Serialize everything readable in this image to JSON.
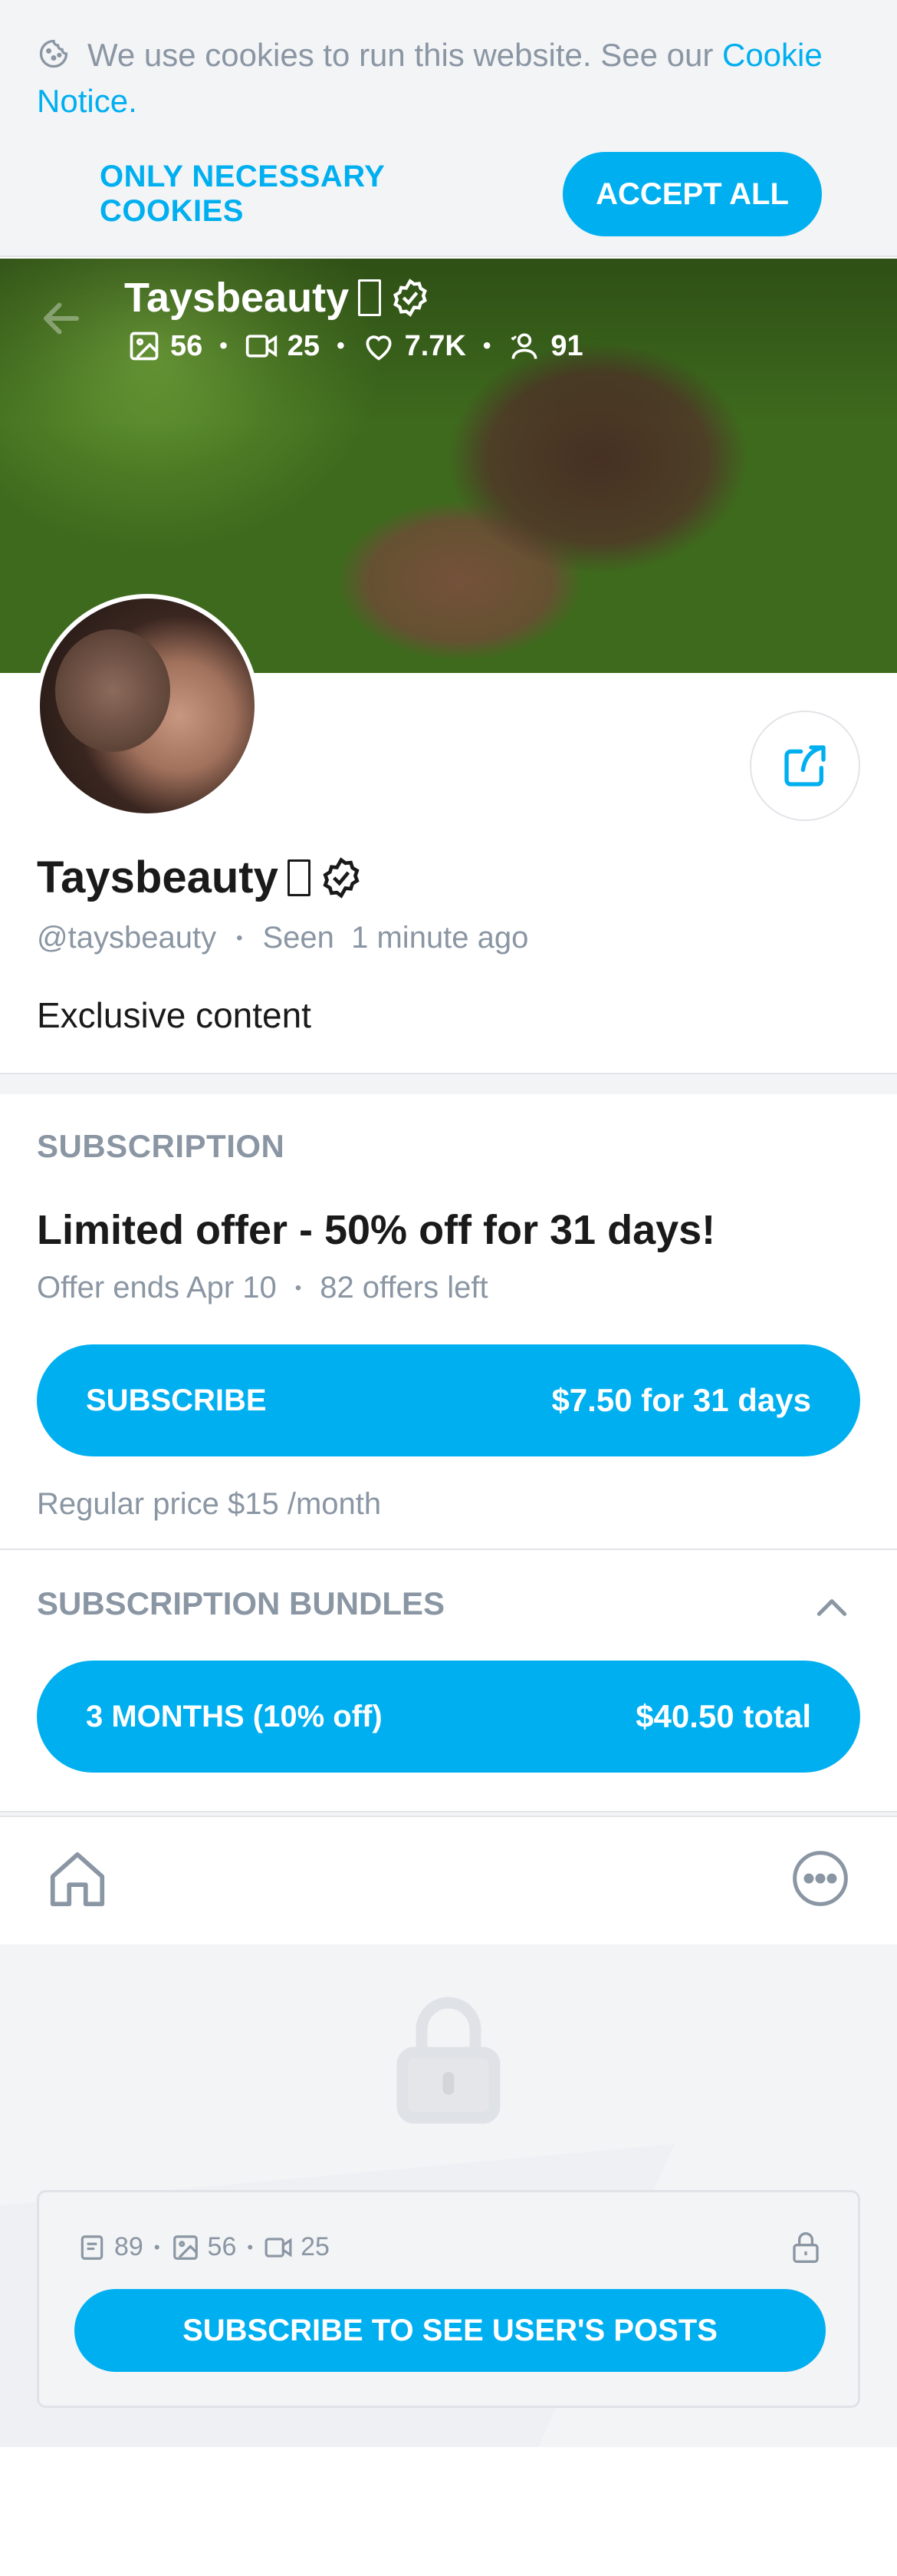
{
  "cookie_banner": {
    "text": "We use cookies to run this website. See our ",
    "link_text": "Cookie Notice",
    "link_suffix": ".",
    "necessary_label": "ONLY NECESSARY COOKIES",
    "accept_label": "ACCEPT ALL"
  },
  "header": {
    "name": "Taysbeauty",
    "stats": {
      "photos": "56",
      "videos": "25",
      "likes": "7.7K",
      "fans": "91"
    }
  },
  "profile": {
    "name": "Taysbeauty",
    "username": "@taysbeauty",
    "seen_label": "Seen",
    "seen_time": "1 minute ago",
    "about": "Exclusive content"
  },
  "subscription": {
    "heading": "SUBSCRIPTION",
    "offer_title": "Limited offer - 50% off for 31 days!",
    "offer_ends": "Offer ends Apr 10",
    "offers_left": "82 offers left",
    "subscribe_label": "SUBSCRIBE",
    "subscribe_price": "$7.50 for 31 days",
    "regular_price": "Regular price $15 /month"
  },
  "bundles": {
    "heading": "SUBSCRIPTION BUNDLES",
    "items": [
      {
        "label": "3 MONTHS (10% off)",
        "price": "$40.50 total"
      }
    ]
  },
  "locked": {
    "stats": {
      "posts": "89",
      "photos": "56",
      "videos": "25"
    },
    "button_label": "SUBSCRIBE TO SEE USER'S POSTS"
  },
  "colors": {
    "accent": "#00aff0",
    "muted": "#8a96a3",
    "background_alt": "#f3f4f6"
  }
}
